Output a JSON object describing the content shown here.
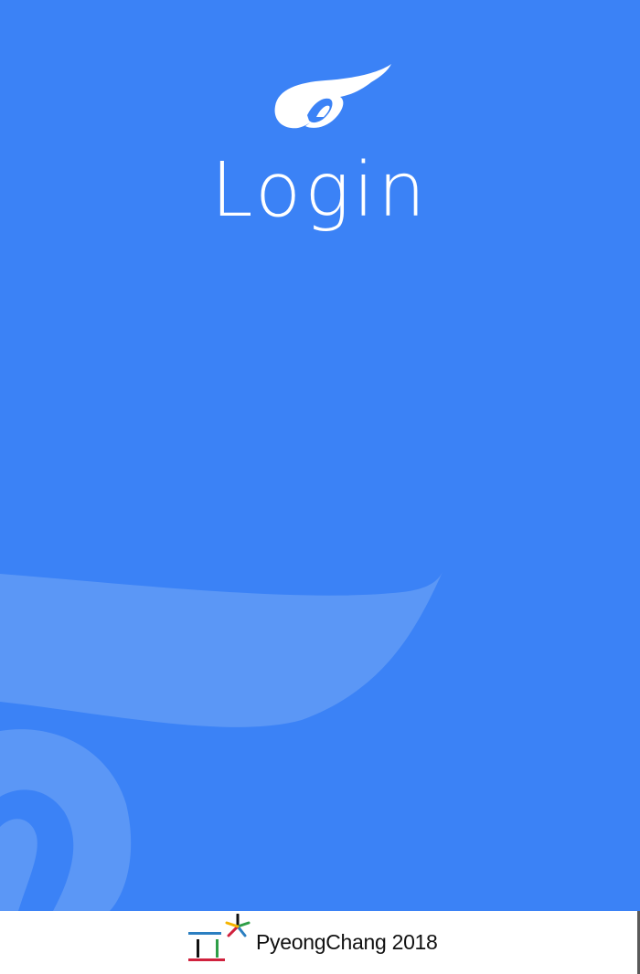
{
  "app": {
    "screen_title": "Login",
    "brand_logo_icon": "swirl-logo-icon"
  },
  "footer": {
    "emblem_icon": "pyeongchang-emblem-icon",
    "text": "PyeongChang 2018"
  },
  "colors": {
    "primary_blue": "#3b82f6",
    "swoosh_blue": "#5b97f6",
    "white": "#ffffff",
    "emblem_blue": "#2b7fc1",
    "emblem_red": "#d0213d",
    "emblem_green": "#2e9e47",
    "emblem_yellow": "#f5b400",
    "emblem_black": "#111111"
  }
}
